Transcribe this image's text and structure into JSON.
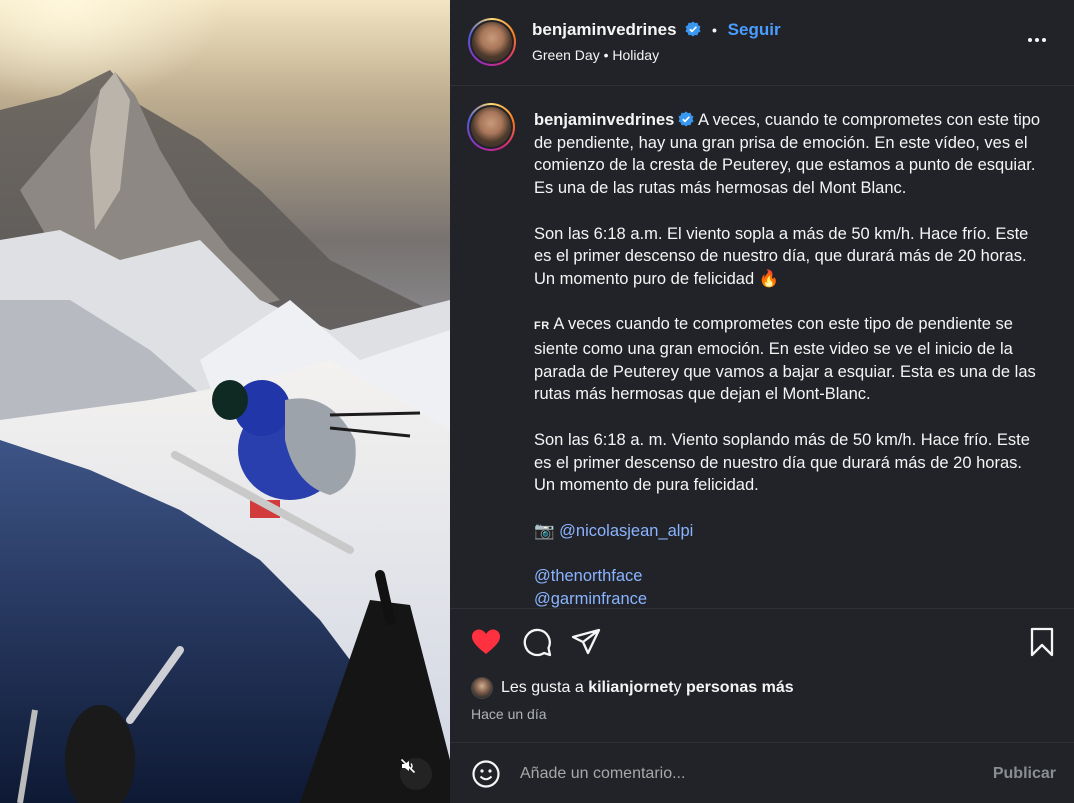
{
  "colors": {
    "panel_bg": "#212328",
    "accent_link": "#4a9dff",
    "mention": "#8ab4ff",
    "like_red": "#ff3040",
    "muted": "#b0b3b8"
  },
  "media": {
    "mute_icon": "speaker-muted-icon"
  },
  "header": {
    "username": "benjaminvedrines",
    "dot": "•",
    "follow_label": "Seguir",
    "music": "Green Day • Holiday",
    "more_icon": "more-horizontal-icon"
  },
  "caption": {
    "username": "benjaminvedrines",
    "p1": " A veces, cuando te comprometes con este tipo de pendiente, hay una gran prisa de emoción. En este vídeo, ves el comienzo de la cresta de Peuterey, que estamos a punto de esquiar. Es una de las rutas más hermosas del Mont Blanc.",
    "p2": "Son las 6:18 a.m. El viento sopla a más de 50 km/h. Hace frío. Este es el primer descenso de nuestro día, que durará más de 20 horas. Un momento puro de felicidad ",
    "fire_emoji": "🔥",
    "fr_tag": "FR",
    "p3": " A veces cuando te comprometes con este tipo de pendiente se siente como una gran emoción. En este video se ve el inicio de la parada de Peuterey que vamos a bajar a esquiar. Esta es una de las rutas más hermosas que dejan el Mont-Blanc.",
    "p4": "Son las 6:18 a. m. Viento soplando más de 50 km/h. Hace frío. Este es el primer descenso de nuestro día que durará más de 20 horas. Un momento de pura felicidad.",
    "camera_emoji": "📷",
    "mention1": "@nicolasjean_alpi",
    "mention2": "@thenorthface",
    "mention3": "@garminfrance"
  },
  "actions": {
    "like_icon": "heart-filled-icon",
    "comment_icon": "comment-icon",
    "share_icon": "send-icon",
    "save_icon": "bookmark-icon"
  },
  "likes": {
    "prefix": "Les gusta a ",
    "user": "kilianjornet",
    "connector": " y ",
    "others": "personas más"
  },
  "time_ago": "Hace un día",
  "comment": {
    "placeholder": "Añade un comentario...",
    "publish_label": "Publicar",
    "emoji_icon": "smiley-icon"
  }
}
